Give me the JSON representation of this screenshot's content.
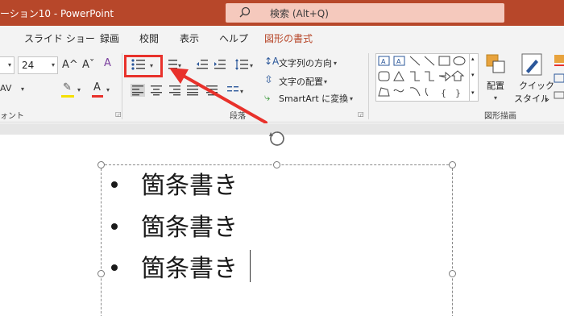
{
  "titlebar": {
    "doc_title": "ーション10  -  PowerPoint",
    "search_text": "検索 (Alt+Q)",
    "background": "#b7472a"
  },
  "tabs": [
    {
      "label": "スライド ショー"
    },
    {
      "label": "録画"
    },
    {
      "label": "校閲"
    },
    {
      "label": "表示"
    },
    {
      "label": "ヘルプ"
    },
    {
      "label": "図形の書式",
      "active": true
    }
  ],
  "ribbon": {
    "font_size_value": "24",
    "grow_font": "A^",
    "shrink_font": "Aˇ",
    "char_spacing": "AV",
    "text_direction_label": "文字列の方向",
    "align_text_label": "文字の配置",
    "smartart_label": "SmartArt に変換",
    "group_font_label": "ォント",
    "group_paragraph_label": "段落",
    "group_drawing_label": "図形描画",
    "arrange_label": "配置",
    "quick_style_label": "クイック",
    "quick_style_label2": "スタイル"
  },
  "slide": {
    "bullets": [
      "箇条書き",
      "箇条書き",
      "箇条書き"
    ]
  },
  "colors": {
    "highlight_red": "#e8312b",
    "accent": "#b7472a"
  },
  "icons": [
    "search-icon",
    "bullets-icon",
    "numbering-icon",
    "decrease-indent-icon",
    "increase-indent-icon",
    "line-spacing-icon",
    "align-left-icon",
    "align-center-icon",
    "align-right-icon",
    "justify-icon",
    "columns-icon",
    "clear-format-icon",
    "highlight-icon",
    "font-color-icon",
    "rotate-icon",
    "arrange-icon",
    "quick-style-icon"
  ]
}
